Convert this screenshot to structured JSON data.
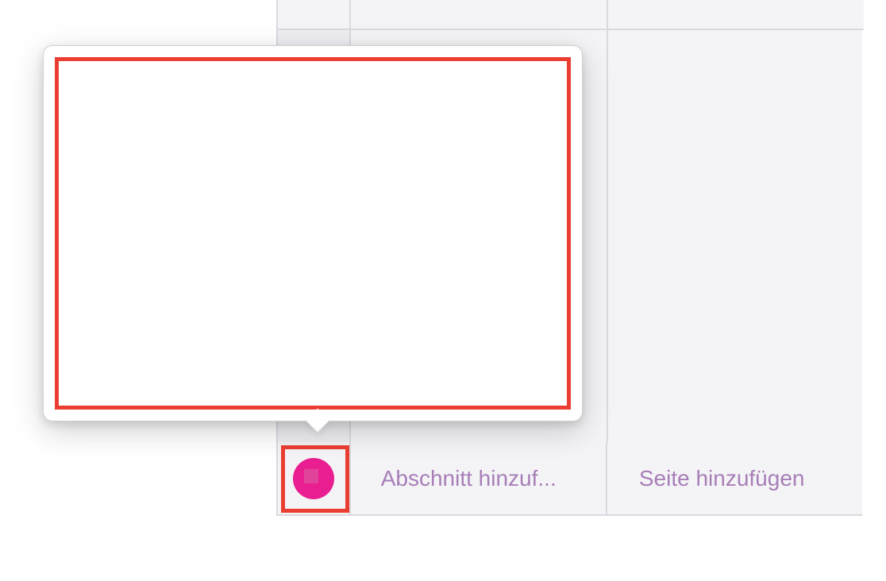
{
  "popover": {
    "highlighted": true
  },
  "bottomBar": {
    "notebookIcon": {
      "name": "notebook-color-icon",
      "color": "#e91e90"
    },
    "addSectionLabel": "Abschnitt hinzuf...",
    "addPageLabel": "Seite hinzufügen"
  },
  "colors": {
    "accent": "#a77eb8",
    "highlight": "#eb3e32",
    "notebookPink": "#e91e90"
  }
}
